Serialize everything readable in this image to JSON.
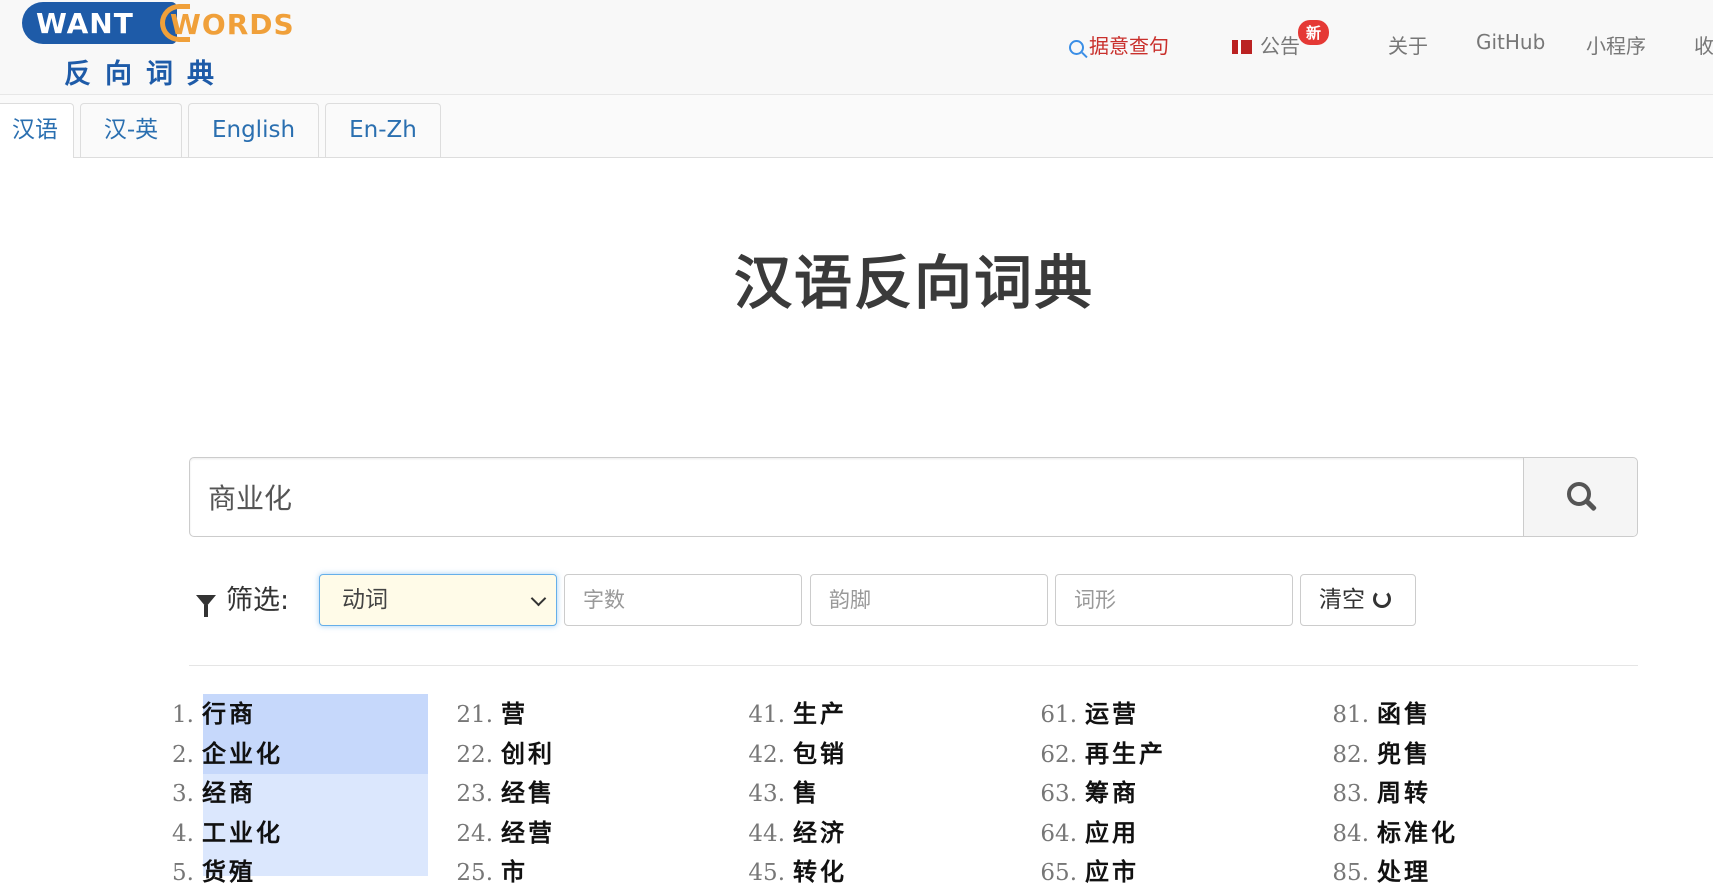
{
  "logo": {
    "want": "WANT",
    "words": "WORDS",
    "cn": "反向词典"
  },
  "nav": {
    "search_label": "据意查句",
    "notice_label": "公告",
    "notice_badge": "新",
    "about": "关于",
    "github": "GitHub",
    "miniprogram": "小程序",
    "collect_partial": "收"
  },
  "tabs": [
    "汉语",
    "汉-英",
    "English",
    "En-Zh"
  ],
  "title": "汉语反向词典",
  "search": {
    "value": "商业化"
  },
  "filter": {
    "label": "筛选:",
    "pos_selected": "动词",
    "char_count_placeholder": "字数",
    "rhyme_placeholder": "韵脚",
    "form_placeholder": "词形",
    "clear_label": "清空"
  },
  "results": [
    [
      {
        "n": "1.",
        "w": "行商"
      },
      {
        "n": "2.",
        "w": "企业化"
      },
      {
        "n": "3.",
        "w": "经商"
      },
      {
        "n": "4.",
        "w": "工业化"
      },
      {
        "n": "5.",
        "w": "货殖"
      }
    ],
    [
      {
        "n": "21.",
        "w": "营"
      },
      {
        "n": "22.",
        "w": "创利"
      },
      {
        "n": "23.",
        "w": "经售"
      },
      {
        "n": "24.",
        "w": "经营"
      },
      {
        "n": "25.",
        "w": "市"
      }
    ],
    [
      {
        "n": "41.",
        "w": "生产"
      },
      {
        "n": "42.",
        "w": "包销"
      },
      {
        "n": "43.",
        "w": "售"
      },
      {
        "n": "44.",
        "w": "经济"
      },
      {
        "n": "45.",
        "w": "转化"
      }
    ],
    [
      {
        "n": "61.",
        "w": "运营"
      },
      {
        "n": "62.",
        "w": "再生产"
      },
      {
        "n": "63.",
        "w": "筹商"
      },
      {
        "n": "64.",
        "w": "应用"
      },
      {
        "n": "65.",
        "w": "应市"
      }
    ],
    [
      {
        "n": "81.",
        "w": "函售"
      },
      {
        "n": "82.",
        "w": "兜售"
      },
      {
        "n": "83.",
        "w": "周转"
      },
      {
        "n": "84.",
        "w": "标准化"
      },
      {
        "n": "85.",
        "w": "处理"
      }
    ]
  ]
}
